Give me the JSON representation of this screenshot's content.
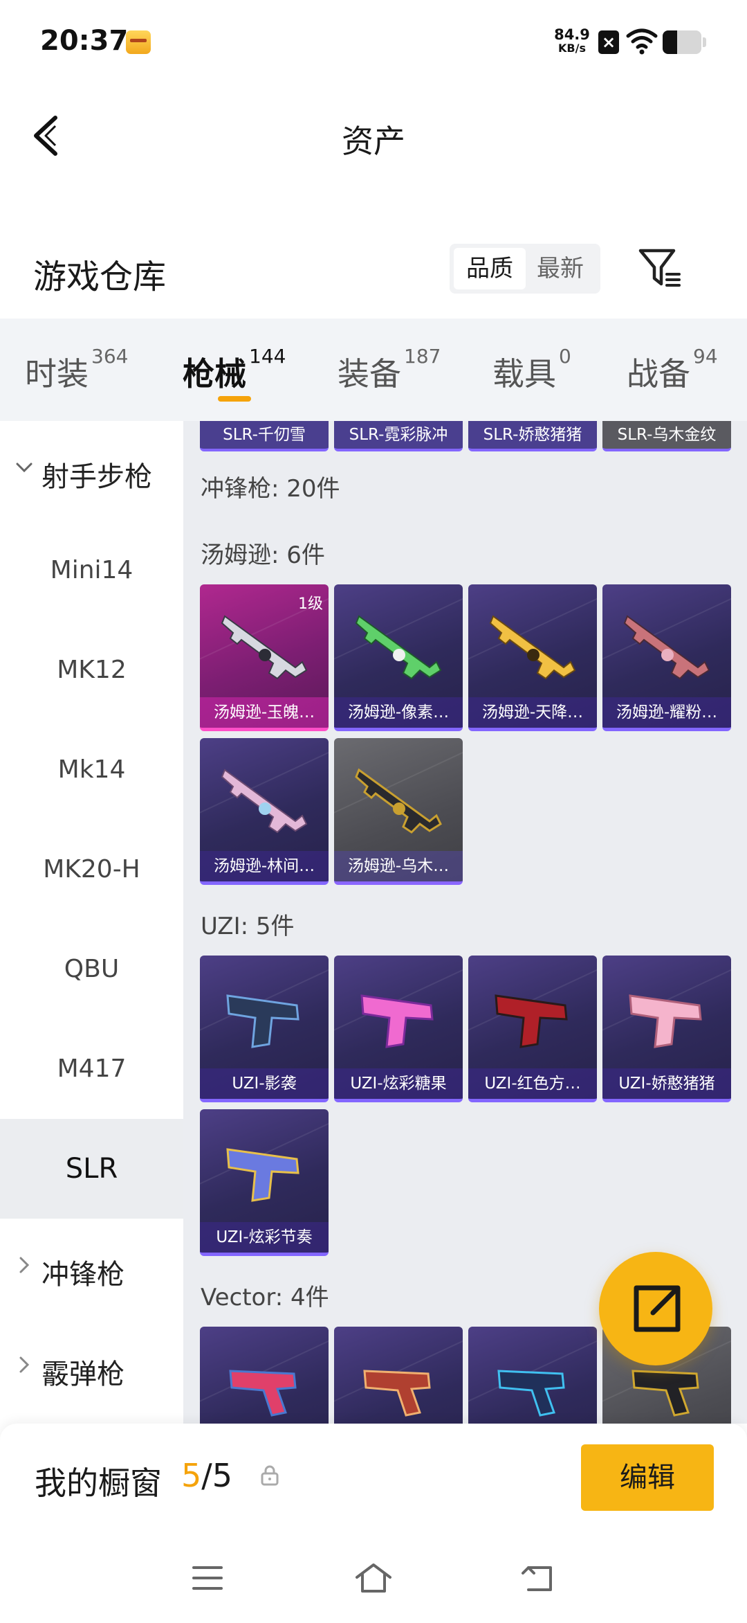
{
  "status_bar": {
    "time": "20:37",
    "net_speed_value": "84.9",
    "net_speed_unit": "KB/s",
    "icons": [
      "app-notification-icon",
      "close-box-icon",
      "wifi-icon",
      "battery-icon"
    ]
  },
  "header": {
    "title": "资产",
    "back_icon": "chevron-left-icon"
  },
  "warehouse": {
    "title": "游戏仓库",
    "sort_options": [
      "品质",
      "最新"
    ],
    "active_sort": "品质",
    "filter_icon": "filter-icon"
  },
  "tabs": [
    {
      "label": "时装",
      "count": "364"
    },
    {
      "label": "枪械",
      "count": "144"
    },
    {
      "label": "装备",
      "count": "187"
    },
    {
      "label": "载具",
      "count": "0"
    },
    {
      "label": "战备",
      "count": "94"
    }
  ],
  "active_tab": "枪械",
  "sidebar": {
    "group_expanded": "射手步枪",
    "sub_items": [
      "Mini14",
      "MK12",
      "Mk14",
      "MK20-H",
      "QBU",
      "M417",
      "SLR"
    ],
    "active_sub": "SLR",
    "collapsed_groups": [
      "冲锋枪",
      "霰弹枪"
    ]
  },
  "content": {
    "top_strip": [
      "SLR-千仞雪",
      "SLR-霓彩脉冲",
      "SLR-娇憨猪猪",
      "SLR-乌木金纹"
    ],
    "section_total": "冲锋枪: 20件",
    "groups": [
      {
        "label": "汤姆逊: 6件",
        "items": [
          {
            "name": "汤姆逊-玉魄…",
            "level": "1级",
            "accent": "#ff4fc7"
          },
          {
            "name": "汤姆逊-像素…",
            "level": "",
            "accent": "#8366ff"
          },
          {
            "name": "汤姆逊-天降…",
            "level": "",
            "accent": "#8366ff"
          },
          {
            "name": "汤姆逊-耀粉…",
            "level": "",
            "accent": "#8366ff"
          },
          {
            "name": "汤姆逊-林间…",
            "level": "",
            "accent": "#8366ff"
          },
          {
            "name": "汤姆逊-乌木…",
            "level": "",
            "accent": "#8366ff"
          }
        ]
      },
      {
        "label": "UZI: 5件",
        "items": [
          {
            "name": "UZI-影袭"
          },
          {
            "name": "UZI-炫彩糖果"
          },
          {
            "name": "UZI-红色方…"
          },
          {
            "name": "UZI-娇憨猪猪"
          },
          {
            "name": "UZI-炫彩节奏"
          }
        ]
      },
      {
        "label": "Vector: 4件",
        "items": [
          {},
          {},
          {},
          {}
        ]
      }
    ]
  },
  "fab_icon": "share-external-icon",
  "bottom_bar": {
    "label": "我的橱窗",
    "count_current": "5",
    "count_sep_total": "/5",
    "lock_icon": "lock-icon",
    "edit_label": "编辑"
  },
  "system_nav": [
    "menu-icon",
    "home-icon",
    "back-icon"
  ],
  "colors": {
    "accent": "#f7b514",
    "tab_underline": "#f5a30b",
    "card_bg": "#2f2a5b",
    "card_border": "#8366ff"
  }
}
